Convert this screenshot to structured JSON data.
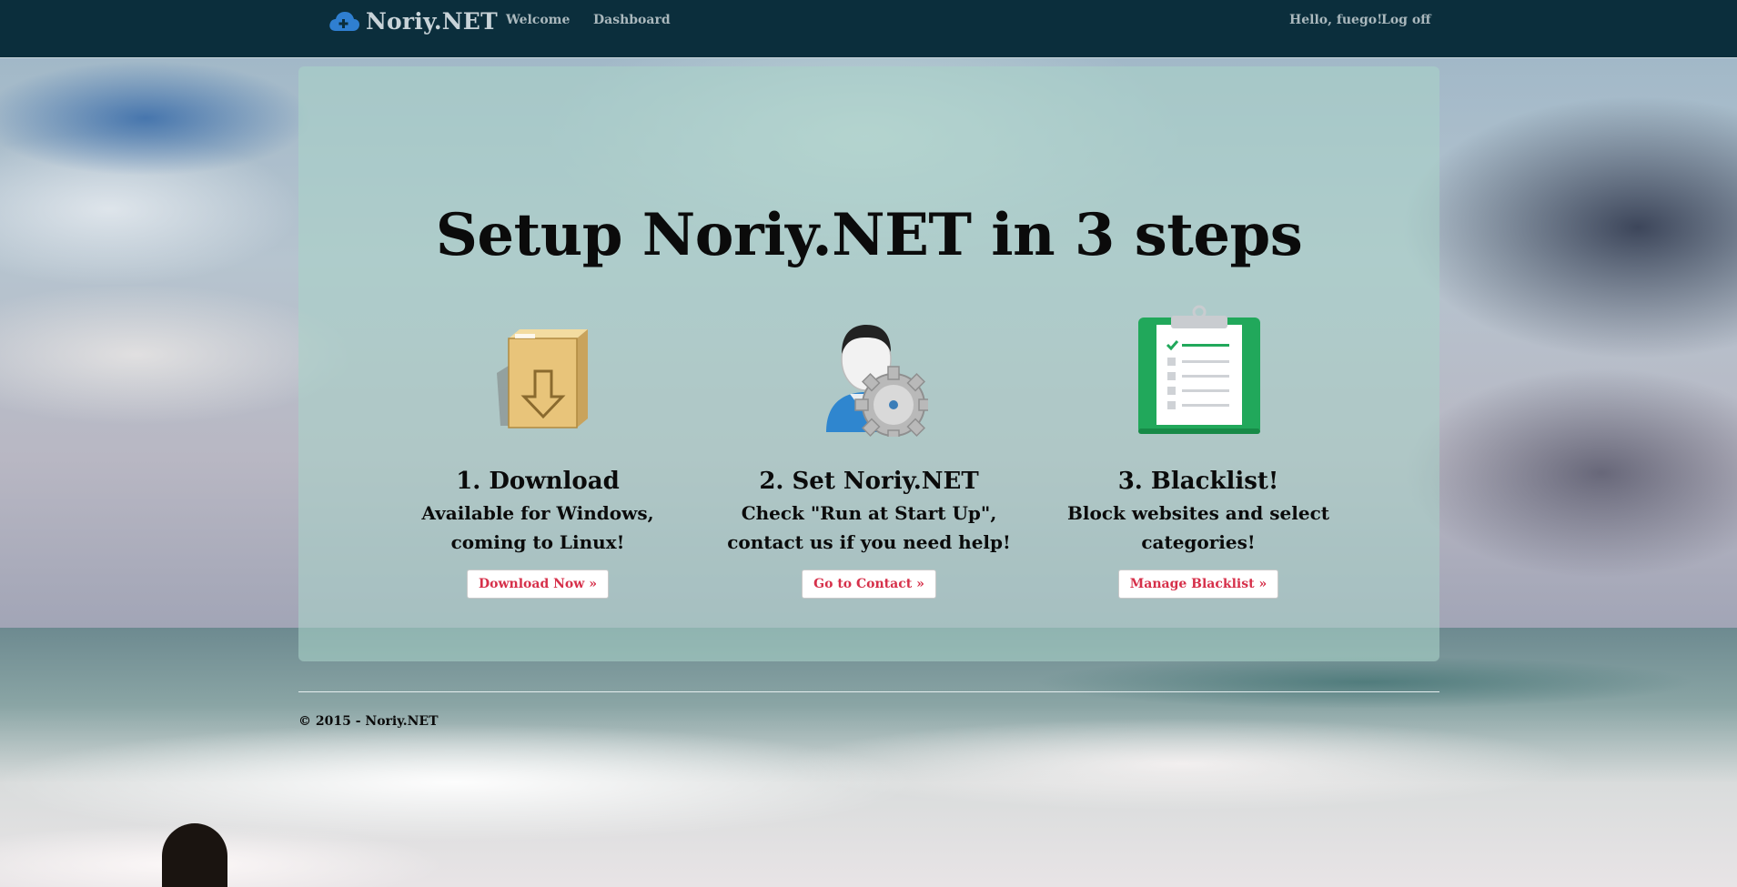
{
  "navbar": {
    "brand": "Noriy.NET",
    "links": [
      "Welcome",
      "Dashboard"
    ],
    "greeting": "Hello, fuego!",
    "logoff": "Log off"
  },
  "hero": {
    "title": "Setup Noriy.NET in 3 steps"
  },
  "steps": [
    {
      "icon": "download-box-icon",
      "heading": "1. Download",
      "text": "Available for Windows, coming to Linux!",
      "button": "Download Now »"
    },
    {
      "icon": "user-settings-icon",
      "heading": "2. Set Noriy.NET",
      "text": "Check \"Run at Start Up\", contact us if you need help!",
      "button": "Go to Contact »"
    },
    {
      "icon": "clipboard-checklist-icon",
      "heading": "3. Blacklist!",
      "text": "Block websites and select categories!",
      "button": "Manage Blacklist »"
    }
  ],
  "footer": {
    "copyright": "© 2015 - Noriy.NET"
  },
  "colors": {
    "navbar": "#0b2e3c",
    "button_text": "#d6304a",
    "jumbotron": "rgba(168,210,200,.58)"
  }
}
